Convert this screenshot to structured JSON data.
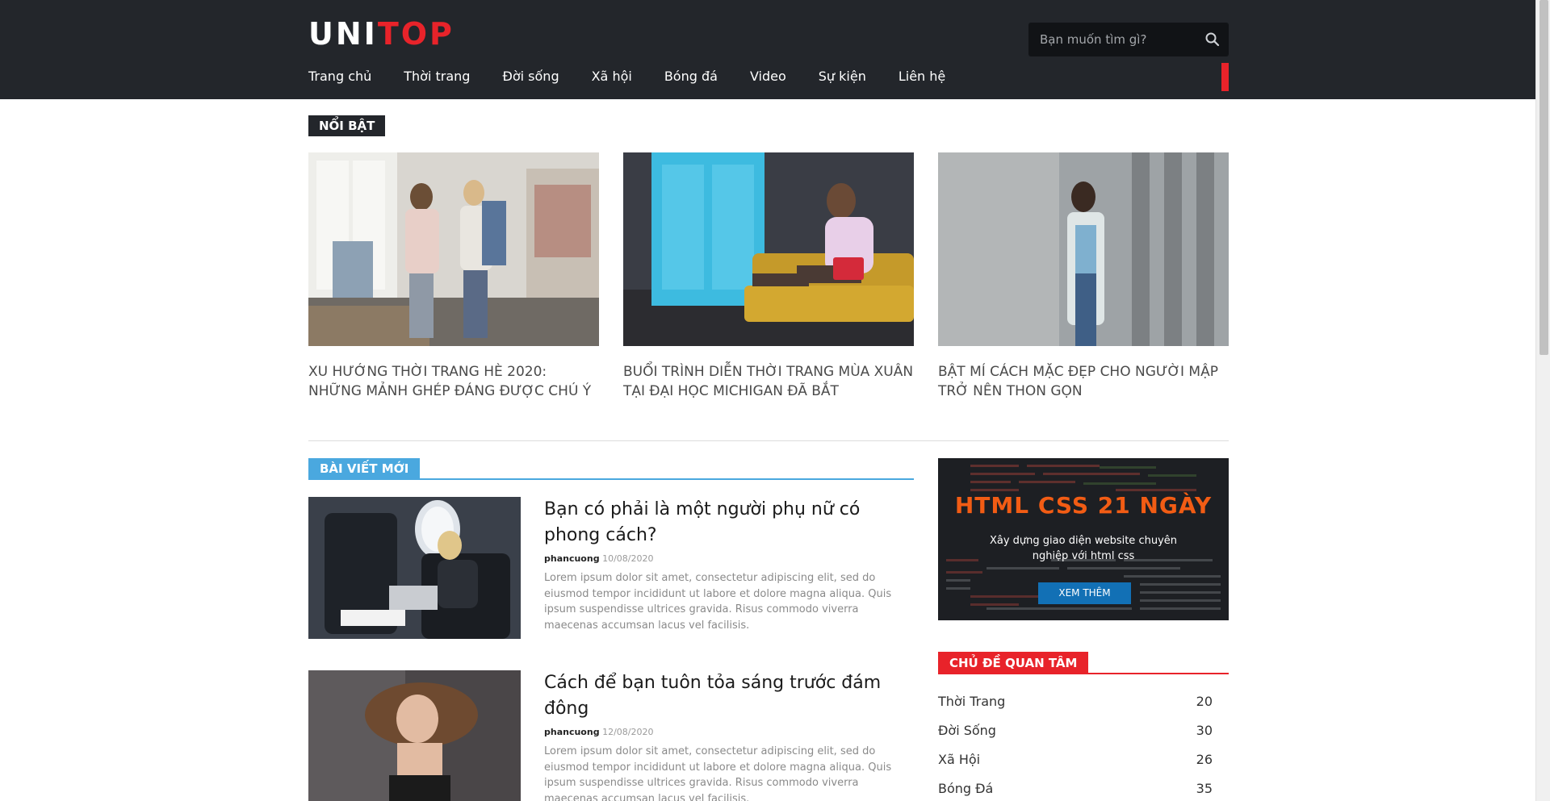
{
  "header": {
    "logo_part1": "UNI",
    "logo_part2": "TOP",
    "search_placeholder": "Bạn muốn tìm gì?",
    "nav": [
      "Trang chủ",
      "Thời trang",
      "Đời sống",
      "Xã hội",
      "Bóng đá",
      "Video",
      "Sự kiện",
      "Liên hệ"
    ]
  },
  "featured": {
    "label": "NỔI BẬT",
    "items": [
      {
        "title": "XU HƯỚNG THỜI TRANG HÈ 2020: NHỮNG MẢNH GHÉP ĐÁNG ĐƯỢC CHÚ Ý"
      },
      {
        "title": "BUỔI TRÌNH DIỄN THỜI TRANG MÙA XUÂN TẠI ĐẠI HỌC MICHIGAN ĐÃ BẮT"
      },
      {
        "title": "BẬT MÍ CÁCH MẶC ĐẸP CHO NGƯỜI MẬP TRỞ NÊN THON GỌN"
      }
    ]
  },
  "latest": {
    "label": "BÀI VIẾT MỚI",
    "posts": [
      {
        "title": "Bạn có phải là một người phụ nữ có phong cách?",
        "author": "phancuong",
        "date": "10/08/2020",
        "excerpt": "Lorem ipsum dolor sit amet, consectetur adipiscing elit, sed do eiusmod tempor incididunt ut labore et dolore magna aliqua. Quis ipsum suspendisse ultrices gravida. Risus commodo viverra maecenas accumsan lacus vel facilisis."
      },
      {
        "title": "Cách để bạn tuôn tỏa sáng trước đám đông",
        "author": "phancuong",
        "date": "12/08/2020",
        "excerpt": "Lorem ipsum dolor sit amet, consectetur adipiscing elit, sed do eiusmod tempor incididunt ut labore et dolore magna aliqua. Quis ipsum suspendisse ultrices gravida. Risus commodo viverra maecenas accumsan lacus vel facilisis."
      }
    ]
  },
  "banner": {
    "title": "HTML CSS 21 NGÀY",
    "subtitle": "Xây dựng giao diện website chuyên nghiệp với html css",
    "button": "XEM THÊM"
  },
  "topics": {
    "label": "CHỦ ĐỀ QUAN TÂM",
    "items": [
      {
        "name": "Thời Trang",
        "count": "20"
      },
      {
        "name": "Đời Sống",
        "count": "30"
      },
      {
        "name": "Xã Hội",
        "count": "26"
      },
      {
        "name": "Bóng Đá",
        "count": "35"
      }
    ]
  },
  "colors": {
    "header_bg": "#23262b",
    "brand_red": "#e8232a",
    "accent_blue": "#4aa8df",
    "banner_orange": "#f25c14",
    "button_blue": "#1270b5"
  }
}
